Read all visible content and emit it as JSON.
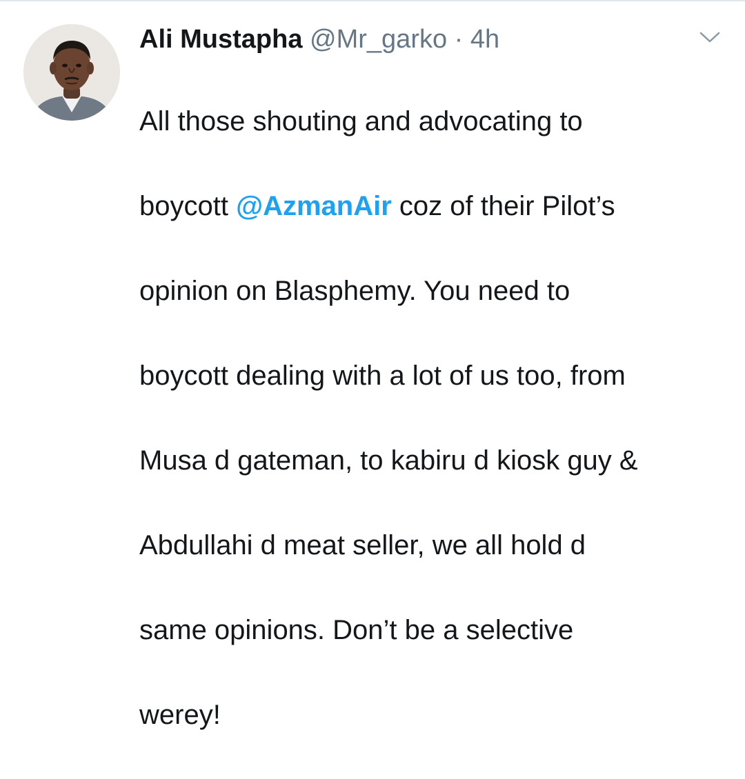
{
  "tweet": {
    "author_name": "Ali Mustapha",
    "handle": "@Mr_garko",
    "separator": "·",
    "timestamp": "4h",
    "text_lines": {
      "l1": "All those shouting and advocating to",
      "l2_pre": "boycott ",
      "l2_mention": "@AzmanAir",
      "l2_post": " coz of their Pilot’s",
      "l3": "opinion on Blasphemy. You need to",
      "l4": "boycott dealing with a lot of us too, from",
      "l5": "Musa d gateman, to kabiru d kiosk guy &",
      "l6": "Abdullahi d meat seller, we all hold d",
      "l7": "same opinions. Don’t be a selective",
      "l8": "werey!"
    }
  },
  "icons": {
    "menu": "chevron-down-icon",
    "avatar": "avatar"
  },
  "colors": {
    "text": "#14171a",
    "secondary": "#657786",
    "mention": "#1da1f2",
    "divider": "#e1e8ed"
  }
}
